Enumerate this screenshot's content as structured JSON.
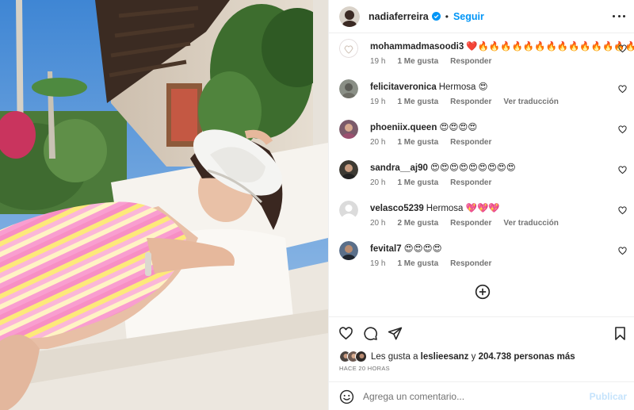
{
  "post": {
    "author": "nadiaferreira",
    "separator": "•",
    "follow_label": "Seguir",
    "photo_alt": "Foto de la publicación"
  },
  "comments": [
    {
      "user": "mohammadmasoodi3",
      "text": "❤️🔥🔥🔥🔥🔥🔥🔥🔥🔥🔥🔥🔥🔥🔥🔥🔥",
      "time": "19 h",
      "likes": "1 Me gusta",
      "reply": "Responder",
      "translate": "",
      "avatar_color": "#f4ecec"
    },
    {
      "user": "felicitaveronica",
      "text": "Hermosa 😍",
      "time": "19 h",
      "likes": "1 Me gusta",
      "reply": "Responder",
      "translate": "Ver traducción",
      "avatar_color": "#8a8f86"
    },
    {
      "user": "phoeniix.queen",
      "text": "😍😍😍😍",
      "time": "20 h",
      "likes": "1 Me gusta",
      "reply": "Responder",
      "translate": "",
      "avatar_color": "#7b5a6a"
    },
    {
      "user": "sandra__aj90",
      "text": "😍😍😍😍😍😍😍😍😍",
      "time": "20 h",
      "likes": "1 Me gusta",
      "reply": "Responder",
      "translate": "",
      "avatar_color": "#3d3a33"
    },
    {
      "user": "velasco5239",
      "text": "Hermosa 💖💖💖",
      "time": "20 h",
      "likes": "2 Me gusta",
      "reply": "Responder",
      "translate": "Ver traducción",
      "avatar_color": "#dbdbdb"
    },
    {
      "user": "fevital7",
      "text": "😍😍😍😍",
      "time": "19 h",
      "likes": "1 Me gusta",
      "reply": "Responder",
      "translate": "",
      "avatar_color": "#5a6f8a"
    }
  ],
  "likes": {
    "prefix": "Les gusta a",
    "user": "leslieesanz",
    "middle": "y",
    "count": "204.738 personas más",
    "time_ago": "HACE 20 HORAS"
  },
  "add_comment": {
    "placeholder": "Agrega un comentario...",
    "post_label": "Publicar"
  },
  "icons": {
    "like": "heart-outline-icon",
    "comment": "comment-bubble-icon",
    "share": "paper-plane-icon",
    "save": "bookmark-icon",
    "emoji": "smiley-icon",
    "more": "more-options-icon",
    "load_more": "plus-circle-icon"
  },
  "colors": {
    "accent": "#0095f6",
    "text": "#262626",
    "secondary": "#737373",
    "border": "#efefef",
    "post_disabled": "#c5e3fc"
  }
}
